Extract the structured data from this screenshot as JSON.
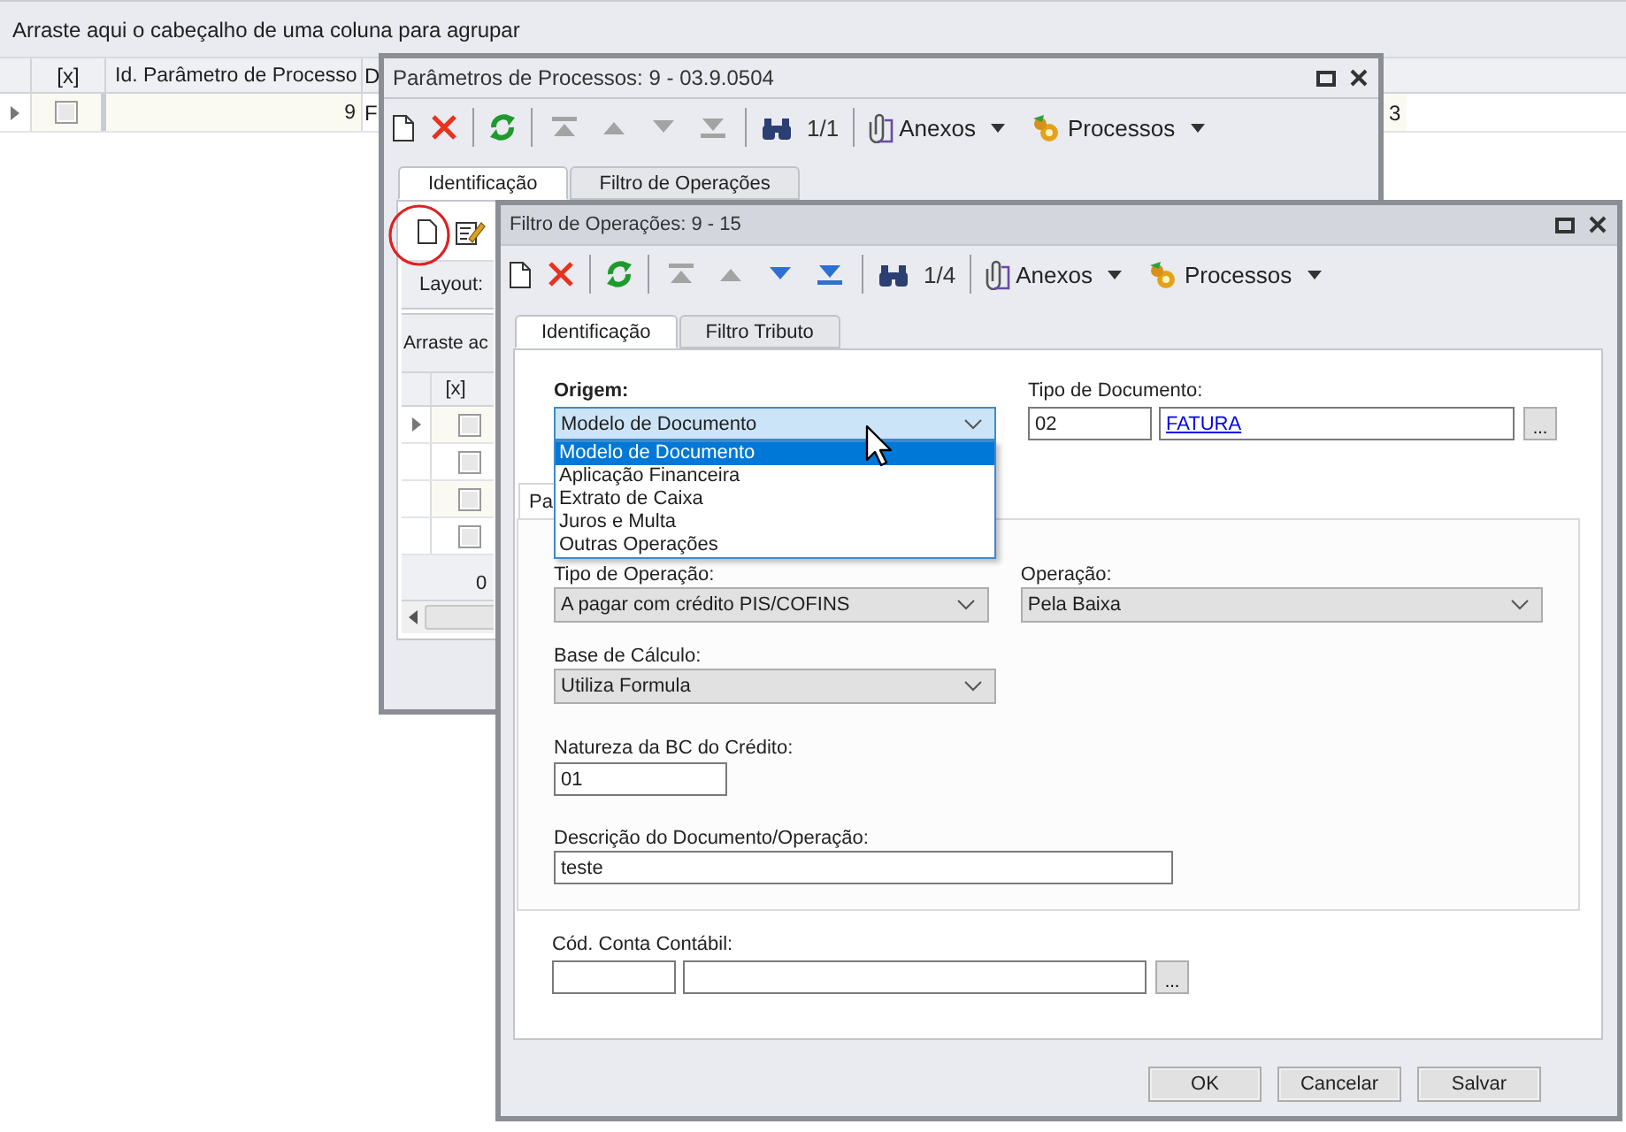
{
  "grid": {
    "group_hint": "Arraste aqui o cabeçalho de uma coluna para agrupar",
    "checkbox_header": "[x]",
    "id_header": "Id. Parâmetro de Processo",
    "column_4_header": "D",
    "rows": [
      {
        "current": true,
        "checked": false,
        "id": "9",
        "column_4": "F",
        "column_5": "3"
      }
    ]
  },
  "params_window": {
    "title": "Parâmetros de Processos: 9 - 03.9.0504",
    "active": false,
    "nav": [
      {
        "kind": "first",
        "disabled": true
      },
      {
        "kind": "prev",
        "disabled": true
      },
      {
        "kind": "next",
        "disabled": true
      },
      {
        "kind": "last",
        "disabled": true
      }
    ],
    "record_counter": "1/1",
    "menus": [
      {
        "kind": "attachments",
        "label": "Anexos"
      },
      {
        "kind": "processes",
        "label": "Processos"
      }
    ],
    "tabs": [
      {
        "label": "Identificação",
        "selected": true
      },
      {
        "label": "Filtro de Operações",
        "selected": false
      }
    ],
    "highlight_new_button": true,
    "layout_label": "Layout:",
    "group_hint": "Arraste ac",
    "grid_column": "[x]",
    "rows": [
      {
        "current": true,
        "checked": false
      },
      {
        "current": false,
        "checked": false
      },
      {
        "current": false,
        "checked": false
      },
      {
        "current": false,
        "checked": false
      }
    ],
    "footer": "0"
  },
  "filter_window": {
    "title": "Filtro de Operações: 9 - 15",
    "active": true,
    "nav": [
      {
        "kind": "first",
        "disabled": true
      },
      {
        "kind": "prev",
        "disabled": true
      },
      {
        "kind": "next",
        "disabled": false
      },
      {
        "kind": "last",
        "disabled": false
      }
    ],
    "record_counter": "1/4",
    "menus": [
      {
        "kind": "attachments",
        "label": "Anexos"
      },
      {
        "kind": "processes",
        "label": "Processos"
      }
    ],
    "tabs": [
      {
        "label": "Identificação",
        "selected": true
      },
      {
        "label": "Filtro Tributo",
        "selected": false
      }
    ],
    "origem": {
      "label": "Origem:",
      "value": "Modelo de Documento",
      "open": true,
      "options": [
        {
          "label": "Modelo de Documento",
          "selected": true
        },
        {
          "label": "Aplicação Financeira",
          "selected": false
        },
        {
          "label": "Extrato de Caixa",
          "selected": false
        },
        {
          "label": "Juros e Multa",
          "selected": false
        },
        {
          "label": "Outras Operações",
          "selected": false
        }
      ]
    },
    "tipo_documento": {
      "label": "Tipo de Documento:",
      "code": "02",
      "name": "FATURA",
      "button": "..."
    },
    "group_tab": "Pa",
    "tipo_operacao": {
      "label": "Tipo de Operação:",
      "value": "A pagar com crédito PIS/COFINS"
    },
    "operacao": {
      "label": "Operação:",
      "value": "Pela Baixa"
    },
    "base_calculo": {
      "label": "Base de Cálculo:",
      "value": "Utiliza Formula"
    },
    "natureza": {
      "label": "Natureza da BC do Crédito:",
      "value": "01"
    },
    "descricao": {
      "label": "Descrição do Documento/Operação:",
      "value": "teste"
    },
    "conta_contabil": {
      "label": "Cód. Conta Contábil:",
      "button": "..."
    },
    "buttons": [
      "OK",
      "Cancelar",
      "Salvar"
    ]
  }
}
